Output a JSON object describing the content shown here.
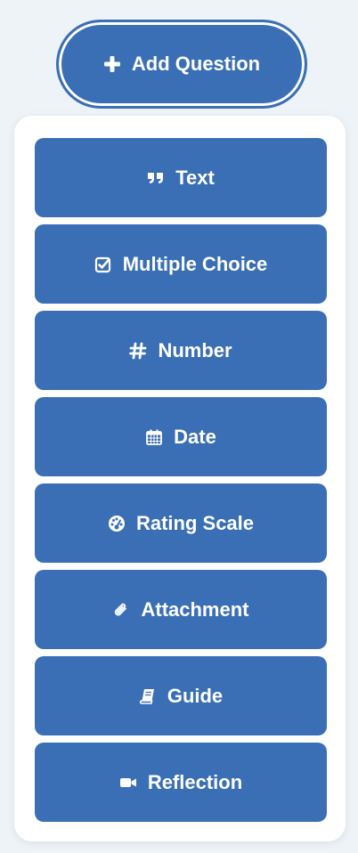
{
  "add_button": {
    "label": "Add Question",
    "icon": "plus-icon"
  },
  "question_types": [
    {
      "label": "Text",
      "icon": "quote-icon"
    },
    {
      "label": "Multiple Choice",
      "icon": "checkbox-icon"
    },
    {
      "label": "Number",
      "icon": "hashtag-icon"
    },
    {
      "label": "Date",
      "icon": "calendar-icon"
    },
    {
      "label": "Rating Scale",
      "icon": "gauge-icon"
    },
    {
      "label": "Attachment",
      "icon": "paperclip-icon"
    },
    {
      "label": "Guide",
      "icon": "book-icon"
    },
    {
      "label": "Reflection",
      "icon": "video-camera-icon"
    }
  ],
  "colors": {
    "accent": "#3a6fb6",
    "background": "#eef3f8",
    "panel": "#ffffff"
  }
}
